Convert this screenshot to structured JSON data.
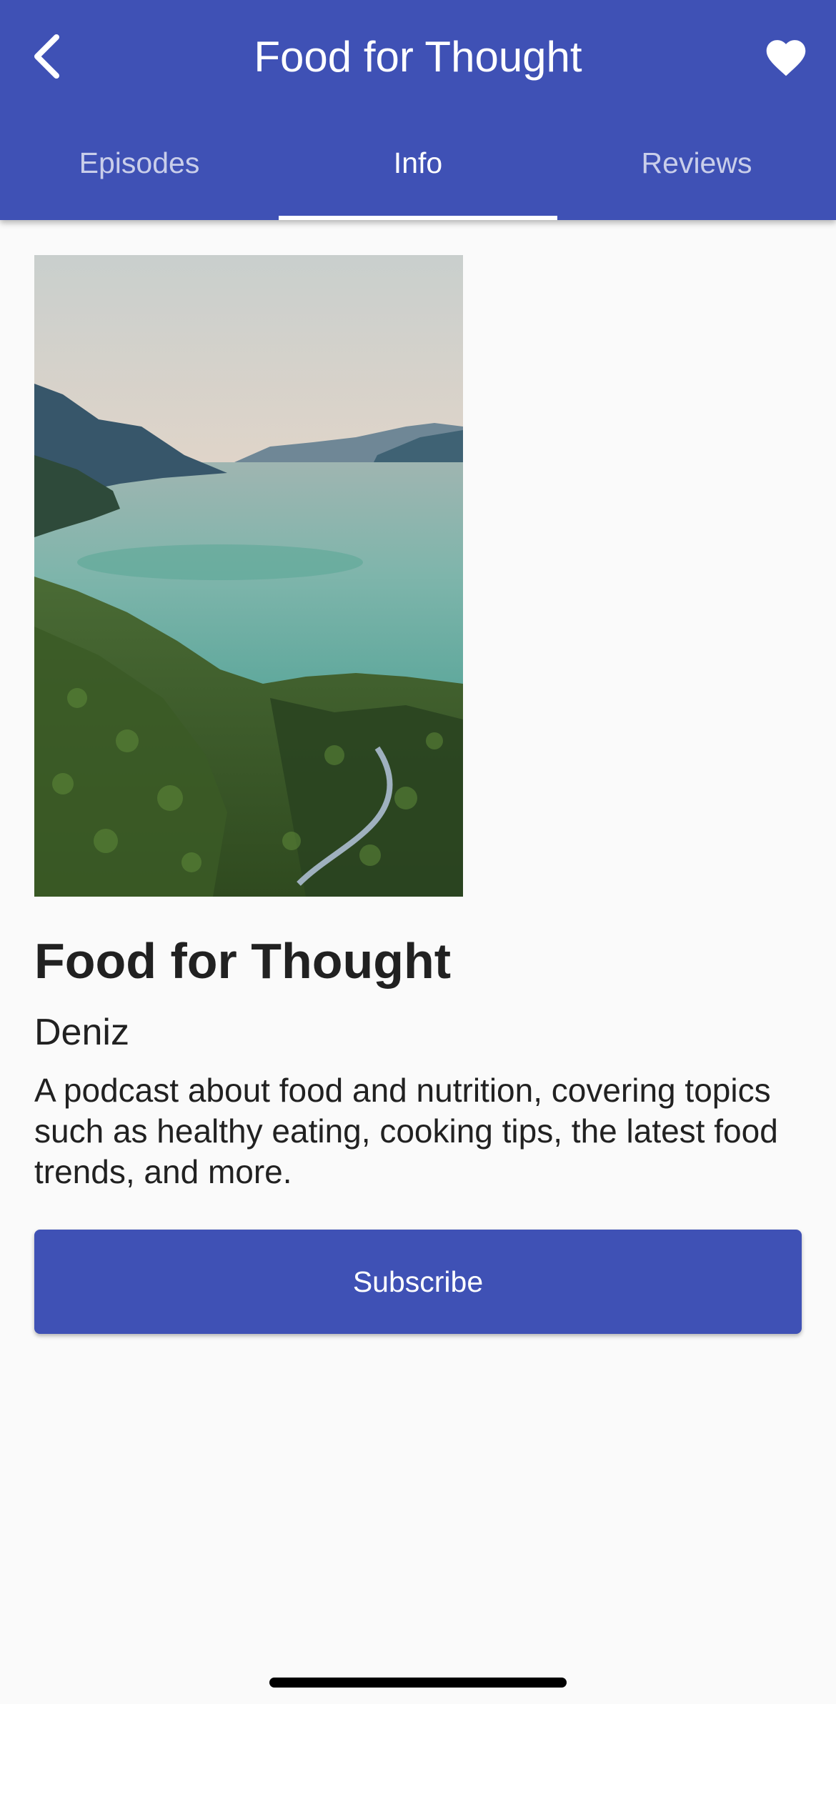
{
  "appbar": {
    "title": "Food for Thought",
    "back_icon": "chevron-left-icon",
    "favorite_icon": "heart-icon"
  },
  "tabs": [
    {
      "label": "Episodes",
      "active": false
    },
    {
      "label": "Info",
      "active": true
    },
    {
      "label": "Reviews",
      "active": false
    }
  ],
  "podcast": {
    "cover_alt": "Mountain lake landscape cover art",
    "title": "Food for Thought",
    "author": "Deniz",
    "description": "A podcast about food and nutrition, covering topics such as healthy eating, cooking tips, the latest food trends, and more."
  },
  "actions": {
    "subscribe_label": "Subscribe"
  },
  "colors": {
    "primary": "#3f51b5",
    "background": "#fafafa",
    "text": "#212121"
  }
}
